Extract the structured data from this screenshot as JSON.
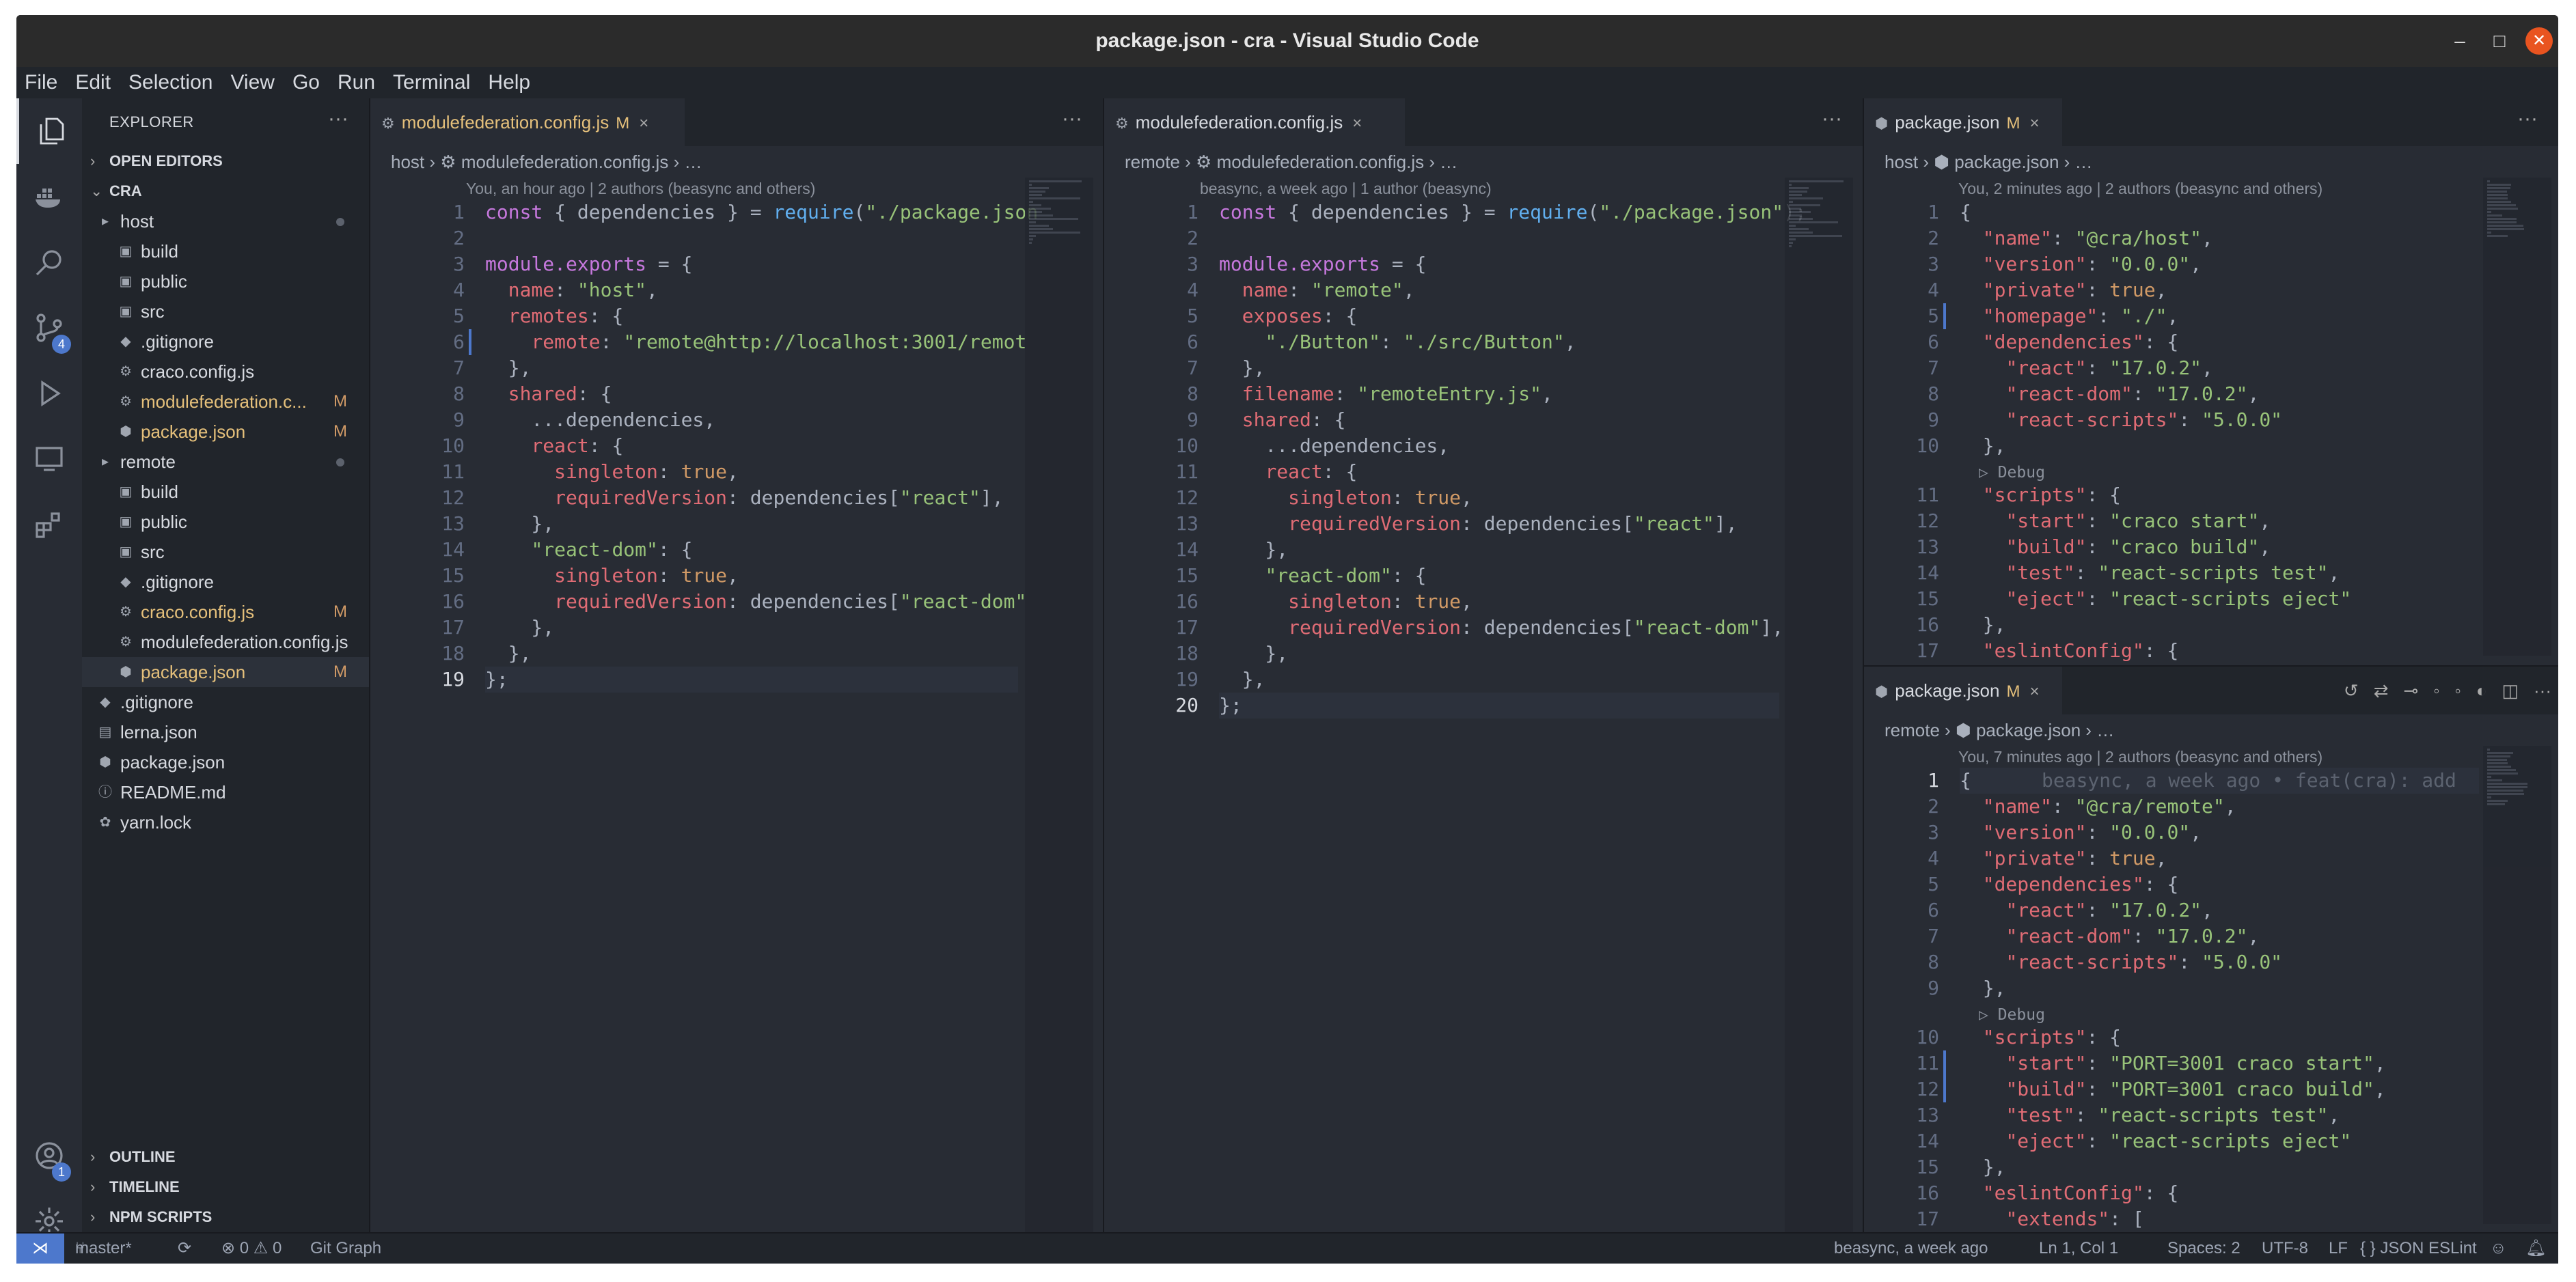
{
  "window": {
    "title": "package.json - cra - Visual Studio Code"
  },
  "menu": [
    "File",
    "Edit",
    "Selection",
    "View",
    "Go",
    "Run",
    "Terminal",
    "Help"
  ],
  "activity": {
    "scm_badge": "4",
    "account_badge": "1"
  },
  "explorer": {
    "title": "EXPLORER",
    "more": "···",
    "open_editors": "OPEN EDITORS",
    "root": "CRA",
    "items": [
      {
        "name": "host",
        "indent": 1,
        "icon": "folder",
        "dot": true
      },
      {
        "name": "build",
        "indent": 2,
        "icon": "folder-build"
      },
      {
        "name": "public",
        "indent": 2,
        "icon": "folder-public"
      },
      {
        "name": "src",
        "indent": 2,
        "icon": "folder-src"
      },
      {
        "name": ".gitignore",
        "indent": 2,
        "icon": "git"
      },
      {
        "name": "craco.config.js",
        "indent": 2,
        "icon": "config"
      },
      {
        "name": "modulefederation.c...",
        "indent": 2,
        "icon": "config",
        "status": "M"
      },
      {
        "name": "package.json",
        "indent": 2,
        "icon": "npm",
        "status": "M"
      },
      {
        "name": "remote",
        "indent": 1,
        "icon": "folder",
        "dot": true
      },
      {
        "name": "build",
        "indent": 2,
        "icon": "folder-build"
      },
      {
        "name": "public",
        "indent": 2,
        "icon": "folder-public"
      },
      {
        "name": "src",
        "indent": 2,
        "icon": "folder-src"
      },
      {
        "name": ".gitignore",
        "indent": 2,
        "icon": "git"
      },
      {
        "name": "craco.config.js",
        "indent": 2,
        "icon": "config",
        "status": "M"
      },
      {
        "name": "modulefederation.config.js",
        "indent": 2,
        "icon": "config"
      },
      {
        "name": "package.json",
        "indent": 2,
        "icon": "npm",
        "status": "M",
        "selected": true
      },
      {
        "name": ".gitignore",
        "indent": 1,
        "icon": "git"
      },
      {
        "name": "lerna.json",
        "indent": 1,
        "icon": "file"
      },
      {
        "name": "package.json",
        "indent": 1,
        "icon": "npm"
      },
      {
        "name": "README.md",
        "indent": 1,
        "icon": "info"
      },
      {
        "name": "yarn.lock",
        "indent": 1,
        "icon": "yarn"
      }
    ],
    "bottom_sections": [
      "OUTLINE",
      "TIMELINE",
      "NPM SCRIPTS"
    ]
  },
  "editors": [
    {
      "tab": {
        "label": "modulefederation.config.js",
        "modified": "M",
        "close": "×"
      },
      "breadcrumb": [
        "host",
        "modulefederation.config.js",
        "…"
      ],
      "lens": "You, an hour ago | 2 authors (beasync and others)",
      "lines": [
        "const { dependencies } = require(\"./package.json",
        "",
        "module.exports = {",
        "  name: \"host\",",
        "  remotes: {",
        "    remote: \"remote@http://localhost:3001/remot",
        "  },",
        "  shared: {",
        "    ...dependencies,",
        "    react: {",
        "      singleton: true,",
        "      requiredVersion: dependencies[\"react\"],",
        "    },",
        "    \"react-dom\": {",
        "      singleton: true,",
        "      requiredVersion: dependencies[\"react-dom\"",
        "    },",
        "  },",
        "};"
      ]
    },
    {
      "tab": {
        "label": "modulefederation.config.js",
        "close": "×"
      },
      "breadcrumb": [
        "remote",
        "modulefederation.config.js",
        "…"
      ],
      "lens": "beasync, a week ago | 1 author (beasync)",
      "lines": [
        "const { dependencies } = require(\"./package.json\");",
        "",
        "module.exports = {",
        "  name: \"remote\",",
        "  exposes: {",
        "    \"./Button\": \"./src/Button\",",
        "  },",
        "  filename: \"remoteEntry.js\",",
        "  shared: {",
        "    ...dependencies,",
        "    react: {",
        "      singleton: true,",
        "      requiredVersion: dependencies[\"react\"],",
        "    },",
        "    \"react-dom\": {",
        "      singleton: true,",
        "      requiredVersion: dependencies[\"react-dom\"],",
        "    },",
        "  },",
        "};"
      ]
    },
    {
      "tab": {
        "label": "package.json",
        "modified": "M",
        "close": "×"
      },
      "breadcrumb": [
        "host",
        "package.json",
        "…"
      ],
      "lens": "You, 2 minutes ago | 2 authors (beasync and others)",
      "debug": "▷ Debug",
      "lines": [
        "{",
        "  \"name\": \"@cra/host\",",
        "  \"version\": \"0.0.0\",",
        "  \"private\": true,",
        "  \"homepage\": \"./\",",
        "  \"dependencies\": {",
        "    \"react\": \"17.0.2\",",
        "    \"react-dom\": \"17.0.2\",",
        "    \"react-scripts\": \"5.0.0\"",
        "  },",
        "  \"scripts\": {",
        "    \"start\": \"craco start\",",
        "    \"build\": \"craco build\",",
        "    \"test\": \"react-scripts test\",",
        "    \"eject\": \"react-scripts eject\"",
        "  },",
        "  \"eslintConfig\": {"
      ]
    },
    {
      "tab": {
        "label": "package.json",
        "modified": "M",
        "close": "×"
      },
      "breadcrumb": [
        "remote",
        "package.json",
        "…"
      ],
      "lens": "You, 7 minutes ago | 2 authors (beasync and others)",
      "blame": "beasync, a week ago • feat(cra): add",
      "debug": "▷ Debug",
      "lines": [
        "{",
        "  \"name\": \"@cra/remote\",",
        "  \"version\": \"0.0.0\",",
        "  \"private\": true,",
        "  \"dependencies\": {",
        "    \"react\": \"17.0.2\",",
        "    \"react-dom\": \"17.0.2\",",
        "    \"react-scripts\": \"5.0.0\"",
        "  },",
        "  \"scripts\": {",
        "    \"start\": \"PORT=3001 craco start\",",
        "    \"build\": \"PORT=3001 craco build\",",
        "    \"test\": \"react-scripts test\",",
        "    \"eject\": \"react-scripts eject\"",
        "  },",
        "  \"eslintConfig\": {",
        "    \"extends\": ["
      ]
    }
  ],
  "status": {
    "branch": "master*",
    "problems": "⊗ 0 ⚠ 0",
    "git_graph": "Git Graph",
    "blame": "beasync, a week ago",
    "position": "Ln 1, Col 1",
    "spaces": "Spaces: 2",
    "encoding": "UTF-8",
    "eol": "LF",
    "language": "{ } JSON",
    "linter": "ESLint"
  },
  "colors": {
    "accent": "#4d78cc",
    "modified": "#e5c07b",
    "bg": "#282c34",
    "sidebar": "#21252b"
  }
}
